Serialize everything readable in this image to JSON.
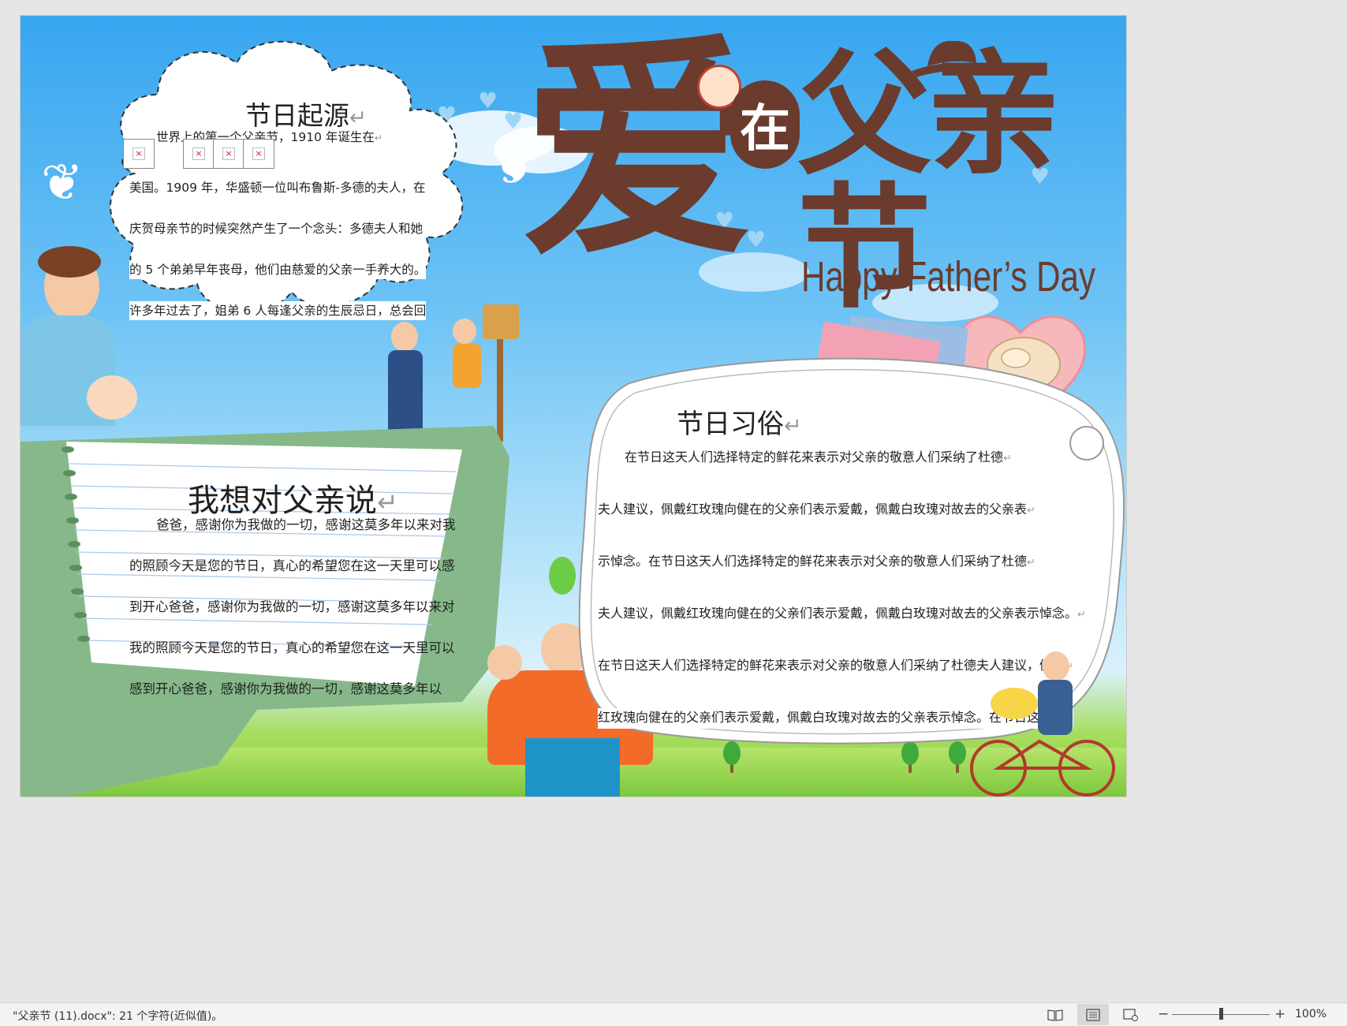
{
  "document": {
    "title_art": {
      "ai": "爱",
      "zai": "在",
      "fuqin_jie": "父亲节",
      "english": "Happy Father’s Day"
    },
    "origin": {
      "heading": "节日起源",
      "lines": [
        "世界上的第一个父亲节，1910 年诞生在",
        "美国。1909 年，华盛顿一位叫布鲁斯-多德的夫人，在",
        "庆贺母亲节的时候突然产生了一个念头：多德夫人和她",
        "的 5 个弟弟早年丧母，他们由慈爱的父亲一手养大的。",
        "许多年过去了，姐弟 6 人每逢父亲的生辰忌日，总会回"
      ],
      "broken_image_glyph": "×"
    },
    "message": {
      "heading": "我想对父亲说",
      "lines": [
        "爸爸，感谢你为我做的一切，感谢这莫多年以来对我",
        "的照顾今天是您的节日，真心的希望您在这一天里可以感",
        "到开心爸爸，感谢你为我做的一切，感谢这莫多年以来对",
        "我的照顾今天是您的节日，真心的希望您在这一天里可以",
        "感到开心爸爸，感谢你为我做的一切，感谢这莫多年以"
      ]
    },
    "customs": {
      "heading": "节日习俗",
      "lines": [
        "在节日这天人们选择特定的鲜花来表示对父亲的敬意人们采纳了杜德",
        "夫人建议，佩戴红玫瑰向健在的父亲们表示爱戴，佩戴白玫瑰对故去的父亲表",
        "示悼念。在节日这天人们选择特定的鲜花来表示对父亲的敬意人们采纳了杜德",
        "夫人建议，佩戴红玫瑰向健在的父亲们表示爱戴，佩戴白玫瑰对故去的父亲表示悼念。",
        "在节日这天人们选择特定的鲜花来表示对父亲的敬意人们采纳了杜德夫人建议，佩戴",
        "红玫瑰向健在的父亲们表示爱戴，佩戴白玫瑰对故去的父亲表示悼念。在节日这天人"
      ]
    },
    "paragraph_mark": "↵"
  },
  "statusbar": {
    "doc_info": "\"父亲节 (11).docx\": 21 个字符(近似值)。",
    "zoom_minus": "−",
    "zoom_plus": "+",
    "zoom_level": "100%",
    "zoom_fraction": 0.5,
    "views": [
      "read-mode-icon",
      "print-layout-icon",
      "web-layout-icon"
    ]
  },
  "colors": {
    "title_brown": "#6b3b2e",
    "sky_top": "#37a6f0",
    "notebook_green": "#86b889"
  }
}
